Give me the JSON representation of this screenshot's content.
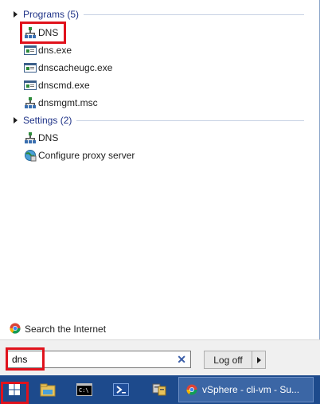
{
  "programs_group": {
    "title": "Programs (5)"
  },
  "programs": [
    {
      "label": "DNS",
      "icon": "dns-console-icon"
    },
    {
      "label": "dns.exe",
      "icon": "exe-icon"
    },
    {
      "label": "dnscacheugc.exe",
      "icon": "exe-icon"
    },
    {
      "label": "dnscmd.exe",
      "icon": "exe-icon"
    },
    {
      "label": "dnsmgmt.msc",
      "icon": "dns-console-icon"
    }
  ],
  "settings_group": {
    "title": "Settings (2)"
  },
  "settings": [
    {
      "label": "DNS",
      "icon": "dns-console-icon"
    },
    {
      "label": "Configure proxy server",
      "icon": "proxy-icon"
    }
  ],
  "search_internet": {
    "label": "Search the Internet",
    "icon": "chrome-icon"
  },
  "search": {
    "value": "dns",
    "clear_icon": "clear-icon"
  },
  "logoff": {
    "label": "Log off"
  },
  "taskbar": {
    "start_icon": "windows-logo-icon",
    "pinned": [
      "file-explorer-icon",
      "command-prompt-icon",
      "powershell-icon",
      "server-manager-icon"
    ],
    "task_label": "vSphere - cli-vm - Su..."
  },
  "colors": {
    "highlight": "#e0121c",
    "group_title": "#1e3287",
    "taskbar": "#1d4a8c"
  }
}
